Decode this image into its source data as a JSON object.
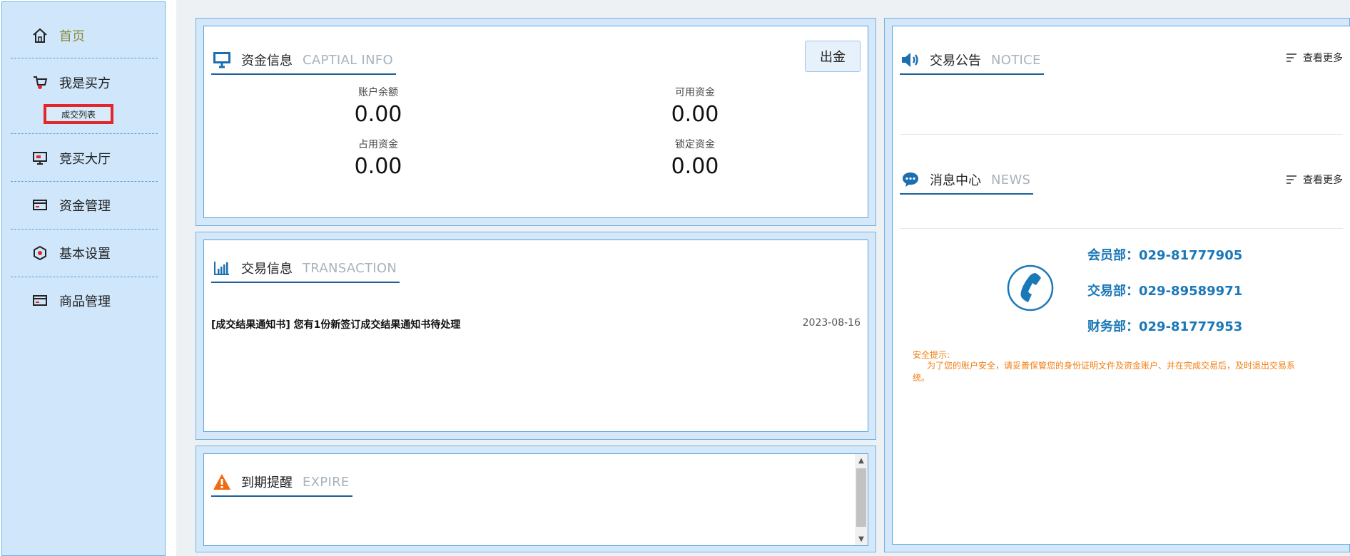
{
  "sidebar": {
    "items": [
      {
        "label": "首页",
        "icon": "home-icon"
      },
      {
        "label": "我是买方",
        "icon": "cart-icon",
        "submenu": [
          {
            "label": "成交列表"
          }
        ]
      },
      {
        "label": "竞买大厅",
        "icon": "monitor-icon"
      },
      {
        "label": "资金管理",
        "icon": "card-icon"
      },
      {
        "label": "基本设置",
        "icon": "settings-icon"
      },
      {
        "label": "商品管理",
        "icon": "card-icon"
      }
    ]
  },
  "funds": {
    "title_cn": "资金信息",
    "title_en": "CAPTIAL INFO",
    "withdraw_label": "出金",
    "items": [
      {
        "label": "账户余额",
        "value": "0.00"
      },
      {
        "label": "可用资金",
        "value": "0.00"
      },
      {
        "label": "占用资金",
        "value": "0.00"
      },
      {
        "label": "锁定资金",
        "value": "0.00"
      }
    ]
  },
  "transaction": {
    "title_cn": "交易信息",
    "title_en": "TRANSACTION",
    "items": [
      {
        "text": "[成交结果通知书] 您有1份新签订成交结果通知书待处理",
        "date": "2023-08-16"
      }
    ]
  },
  "expire": {
    "title_cn": "到期提醒",
    "title_en": "EXPIRE"
  },
  "notice": {
    "title_cn": "交易公告",
    "title_en": "NOTICE",
    "more_label": "查看更多"
  },
  "news": {
    "title_cn": "消息中心",
    "title_en": "NEWS",
    "more_label": "查看更多"
  },
  "contacts": [
    {
      "text": "会员部：029-81777905"
    },
    {
      "text": "交易部：029-89589971"
    },
    {
      "text": "财务部：029-81777953"
    }
  ],
  "safety": {
    "title": "安全提示:",
    "text": "为了您的账户安全，请妥善保管您的身份证明文件及资金账户、并在完成交易后，及时退出交易系统。"
  },
  "colors": {
    "sidebar_bg": "#cfe6fb",
    "accent_blue": "#1b78b8",
    "title_underline": "#1e5f9a",
    "warning_orange": "#f07f14",
    "highlight_red": "#e2262b"
  }
}
